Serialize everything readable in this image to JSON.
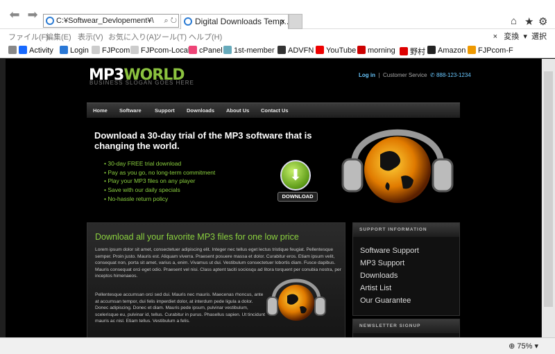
{
  "browser": {
    "address": "C:¥Softwear_Devlopement¥\\",
    "tab_title": "Digital Downloads Temp...",
    "tab_close": "×",
    "menu": [
      "ファイル(F)",
      "編集(E)",
      "表示(V)",
      "お気に入り(A)",
      "ツール(T)",
      "ヘルプ(H)"
    ],
    "menu_close": "×",
    "convert_label": "変換",
    "select_label": "選択",
    "favorites": [
      "Activity",
      "Login",
      "FJPcom",
      "FJPcom-Local",
      "cPanel",
      "1st-member",
      "ADVFN",
      "YouTube",
      "morning",
      "野村",
      "Amazon",
      "FJPcom-F"
    ],
    "zoom": "75%"
  },
  "site": {
    "logo_a": "MP3",
    "logo_b": "WORLD",
    "slogan": "BUSINESS SLOGAN GOES HERE",
    "login": "Log in",
    "sep": "|",
    "customer_service": "Customer Service",
    "phone": "888-123-1234",
    "nav": [
      "Home",
      "Software",
      "Support",
      "Downloads",
      "About Us",
      "Contact Us"
    ],
    "hero_title": "Download a 30-day trial of the MP3 software that is changing the world.",
    "bullets": [
      "30-day FREE trial download",
      "Pay as you go, no long-term commitment",
      "Play your MP3 files on any player",
      "Save with our daily specials",
      "No-hassle return policy"
    ],
    "download_label": "DOWNLOAD",
    "main_heading": "Download all your favorite MP3 files for one low price",
    "para1": "Lorem ipsum dolor sit amet, consectetuer adipiscing elit. Integer nec tellus eget lectus tristique feugiat. Pellentesque semper. Proin justo. Mauris est. Aliquam viverra. Praesent posuere massa et dolor. Curabitur eros. Etiam ipsum velit, consequat non, porta sit amet, varius a, enim. Vivamus ut dui. Vestibulum consectetuer lobortis diam. Fusce dapibus. Mauris consequat orci eget odio. Praesent vel nisi. Class aptent taciti sociosqu ad litora torquent per conubia nostra, per inceptos himenaeos.",
    "para2": "Pellentesque accumsan orci sed dui. Mauris nec mauris. Maecenas rhoncus, ante at accumsan tempor, dui felis imperdiet dolor, at interdum pede ligula a dolor. Donec adipiscing. Donec et diam. Mauris pede ipsum, pulvinar vestibulum, scelerisque eu, pulvinar id, tellus. Curabitur in purus. Phasellus sapien. Ut tincidunt mauris ac nisl. Etiam tellus. Vestibulum a felis.",
    "support_heading": "SUPPORT INFORMATION",
    "support_links": [
      "Software Support",
      "MP3 Support",
      "Downloads",
      "Artist List",
      "Our Guarantee"
    ],
    "newsletter_heading": "NEWSLETTER SIGNUP"
  },
  "colors": {
    "accent": "#8bd13f",
    "link": "#6ac8ff"
  }
}
